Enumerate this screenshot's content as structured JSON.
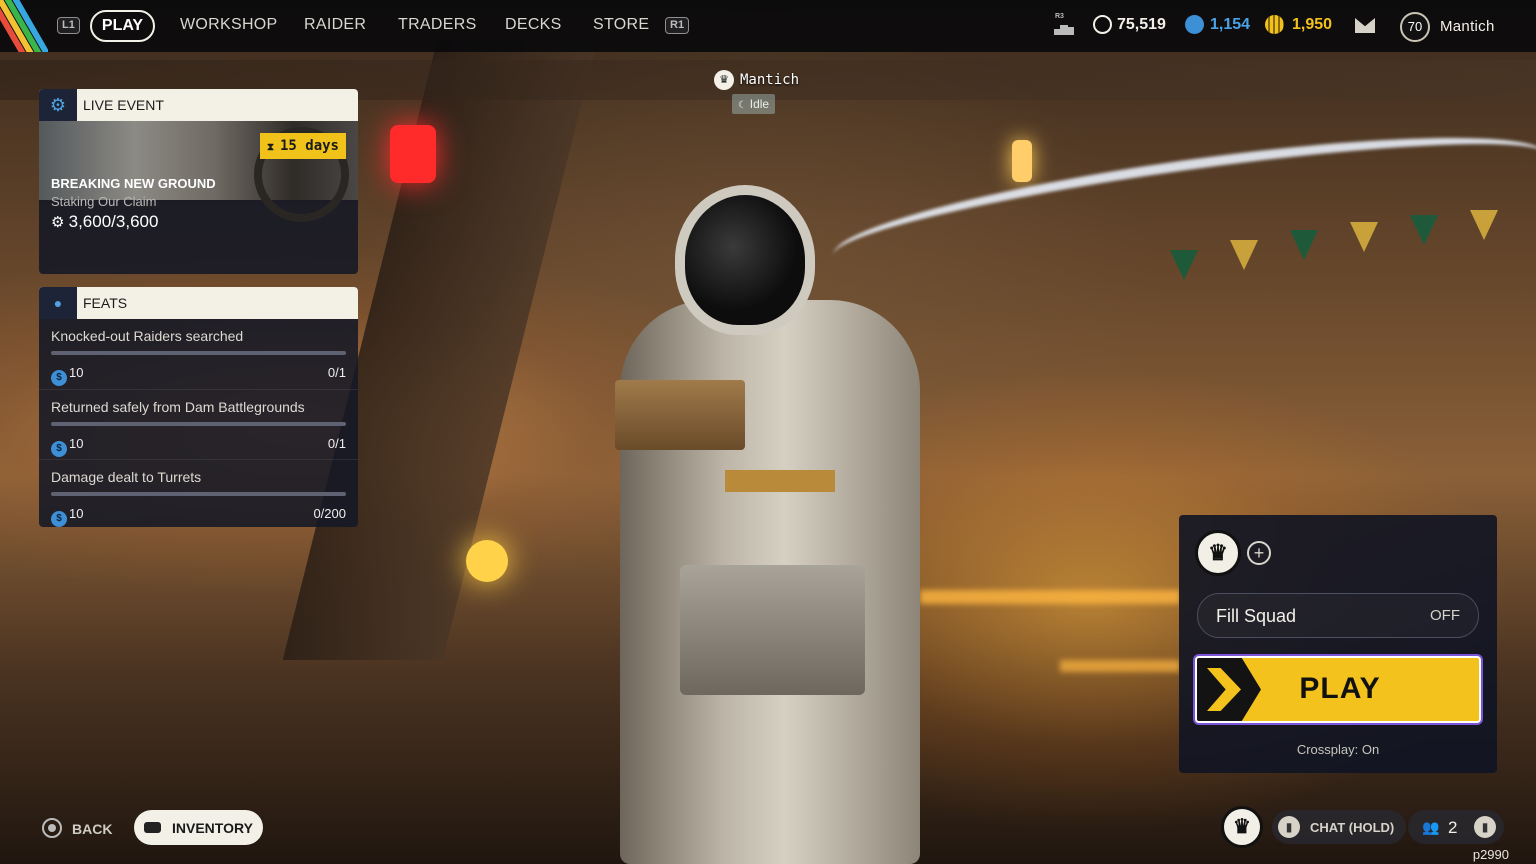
{
  "topbar": {
    "left_hint": "L1",
    "right_hint": "R1",
    "r3_hint": "R3",
    "tabs": [
      {
        "label": "PLAY",
        "active": true
      },
      {
        "label": "WORKSHOP"
      },
      {
        "label": "RAIDER"
      },
      {
        "label": "TRADERS"
      },
      {
        "label": "DECKS"
      },
      {
        "label": "STORE"
      }
    ],
    "currencies": [
      {
        "icon": "coin-icon",
        "value": "75,519",
        "color": "#f3f0e8"
      },
      {
        "icon": "raider-token-icon",
        "value": "1,154",
        "color": "#4aa3e6"
      },
      {
        "icon": "premium-coin-icon",
        "value": "1,950",
        "color": "#f0c21a"
      }
    ],
    "mail_icon": "mail-icon",
    "player_level": "70",
    "player_name": "Mantich"
  },
  "live_event": {
    "header": "LIVE EVENT",
    "days": "15 days",
    "title": "BREAKING NEW GROUND",
    "subtitle": "Staking Our Claim",
    "progress": "3,600/3,600"
  },
  "feats": {
    "header": "FEATS",
    "items": [
      {
        "name": "Knocked-out Raiders searched",
        "reward": "10",
        "count": "0/1",
        "progress": 0
      },
      {
        "name": "Returned safely from Dam Battlegrounds",
        "reward": "10",
        "count": "0/1",
        "progress": 0
      },
      {
        "name": "Damage dealt to Turrets",
        "reward": "10",
        "count": "0/200",
        "progress": 0
      }
    ]
  },
  "player_tag": {
    "name": "Mantich",
    "status": "Idle"
  },
  "squad": {
    "fill_label": "Fill Squad",
    "fill_value": "OFF",
    "play_label": "PLAY",
    "crossplay": "Crossplay: On"
  },
  "bottom": {
    "back": "BACK",
    "inventory": "INVENTORY",
    "chat": "CHAT (HOLD)",
    "party_count": "2",
    "build": "p2990"
  },
  "colors": {
    "accent_yellow": "#f4c21c",
    "panel_bg": "#141826",
    "header_bg": "#f3f0e6",
    "blue": "#3d8fd6"
  }
}
